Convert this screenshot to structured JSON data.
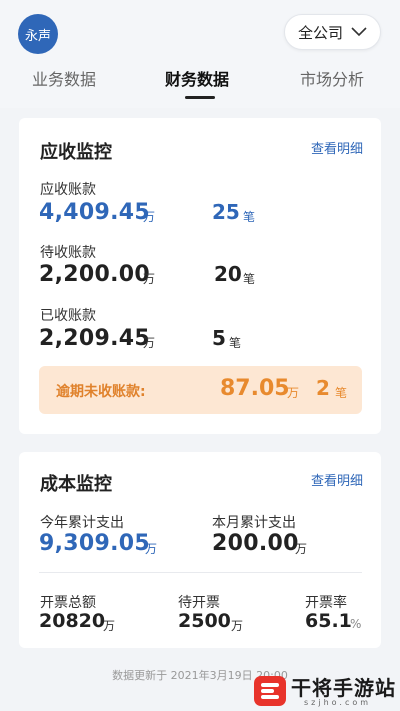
{
  "header": {
    "avatar_text": "永声",
    "company_selector": "全公司"
  },
  "tabs": [
    {
      "label": "业务数据",
      "active": false
    },
    {
      "label": "财务数据",
      "active": true
    },
    {
      "label": "市场分析",
      "active": false
    }
  ],
  "receivables": {
    "title": "应收监控",
    "detail_link": "查看明细",
    "rows": [
      {
        "label": "应收账款",
        "amount": "4,409.45",
        "amount_unit": "万",
        "count": "25",
        "count_unit": "笔"
      },
      {
        "label": "待收账款",
        "amount": "2,200.00",
        "amount_unit": "万",
        "count": "20",
        "count_unit": "笔"
      },
      {
        "label": "已收账款",
        "amount": "2,209.45",
        "amount_unit": "万",
        "count": "5",
        "count_unit": "笔"
      }
    ],
    "overdue": {
      "label": "逾期未收账款:",
      "amount": "87.05",
      "amount_unit": "万",
      "count": "2",
      "count_unit": "笔"
    }
  },
  "cost": {
    "title": "成本监控",
    "detail_link": "查看明细",
    "year": {
      "label": "今年累计支出",
      "amount": "9,309.05",
      "unit": "万"
    },
    "month": {
      "label": "本月累计支出",
      "amount": "200.00",
      "unit": "万"
    },
    "invoice_total": {
      "label": "开票总额",
      "value": "20820",
      "unit": "万"
    },
    "invoice_pending": {
      "label": "待开票",
      "value": "2500",
      "unit": "万"
    },
    "invoice_rate": {
      "label": "开票率",
      "value": "65.1",
      "unit": "%"
    }
  },
  "footer": {
    "update_text": "数据更新于  2021年3月19日 20:00"
  },
  "watermark": {
    "text": "干将手游站",
    "sub": "szjho.com"
  },
  "colors": {
    "accent": "#2f67b8",
    "overdue_bg": "#fde7d3",
    "overdue_text": "#e88a2e"
  }
}
